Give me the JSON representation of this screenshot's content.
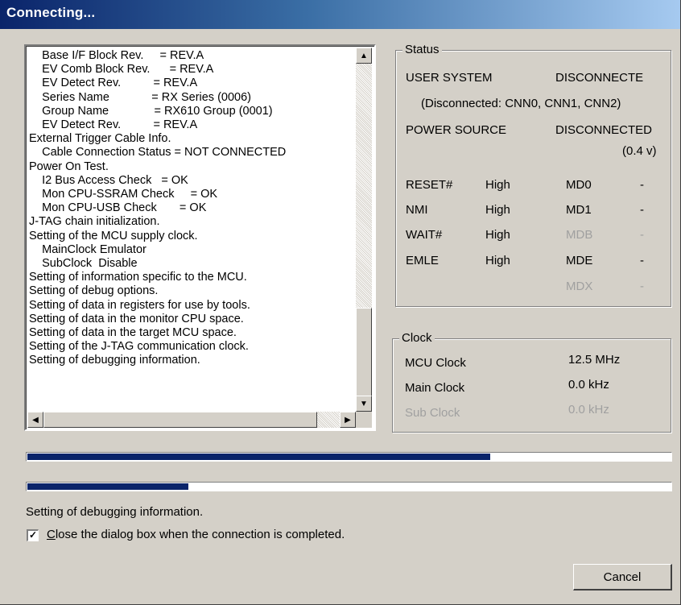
{
  "window": {
    "title": "Connecting..."
  },
  "log": {
    "lines": [
      "    Base I/F Block Rev.     = REV.A",
      "    EV Comb Block Rev.      = REV.A",
      "    EV Detect Rev.          = REV.A",
      "    Series Name             = RX Series (0006)",
      "    Group Name              = RX610 Group (0001)",
      "    EV Detect Rev.          = REV.A",
      "External Trigger Cable Info.",
      "    Cable Connection Status = NOT CONNECTED",
      "Power On Test.",
      "    I2 Bus Access Check   = OK",
      "    Mon CPU-SSRAM Check     = OK",
      "    Mon CPU-USB Check       = OK",
      "J-TAG chain initialization.",
      "Setting of the MCU supply clock.",
      "    MainClock Emulator",
      "    SubClock  Disable",
      "Setting of information specific to the MCU.",
      "Setting of debug options.",
      "Setting of data in registers for use by tools.",
      "Setting of data in the monitor CPU space.",
      "Setting of data in the target MCU space.",
      "Setting of the J-TAG communication clock.",
      "Setting of debugging information."
    ],
    "scroll_up": "▲",
    "scroll_down": "▼",
    "scroll_left": "◀",
    "scroll_right": "▶"
  },
  "status": {
    "title": "Status",
    "user_system_label": "USER SYSTEM",
    "user_system_value": "DISCONNECTE",
    "user_system_detail": "(Disconnected: CNN0, CNN1, CNN2)",
    "power_source_label": "POWER SOURCE",
    "power_source_value": "DISCONNECTED",
    "power_source_voltage": "(0.4 v)",
    "signals": [
      {
        "name": "RESET#",
        "level": "High",
        "md": "MD0",
        "md_value": "-",
        "md_enabled": true
      },
      {
        "name": "NMI",
        "level": "High",
        "md": "MD1",
        "md_value": "-",
        "md_enabled": true
      },
      {
        "name": "WAIT#",
        "level": "High",
        "md": "MDB",
        "md_value": "-",
        "md_enabled": false
      },
      {
        "name": "EMLE",
        "level": "High",
        "md": "MDE",
        "md_value": "-",
        "md_enabled": true
      }
    ],
    "mdx_label": "MDX",
    "mdx_value": "-"
  },
  "clock": {
    "title": "Clock",
    "mcu_label": "MCU Clock",
    "mcu_value": "12.5 MHz",
    "main_label": "Main Clock",
    "main_value": "0.0 kHz",
    "sub_label": "Sub Clock",
    "sub_value": "0.0 kHz"
  },
  "progress": {
    "overall_fraction": 0.72,
    "step_fraction": 0.25
  },
  "status_message": "Setting of debugging information.",
  "close_checkbox": {
    "checked": true,
    "mark": "✓",
    "label_mnemonic": "C",
    "label_rest": "lose the dialog box when the connection is completed."
  },
  "buttons": {
    "cancel": "Cancel"
  },
  "colors": {
    "title_bar_start": "#0a246a",
    "progress_fill": "#0a246a",
    "dialog_face": "#d4d0c8"
  }
}
